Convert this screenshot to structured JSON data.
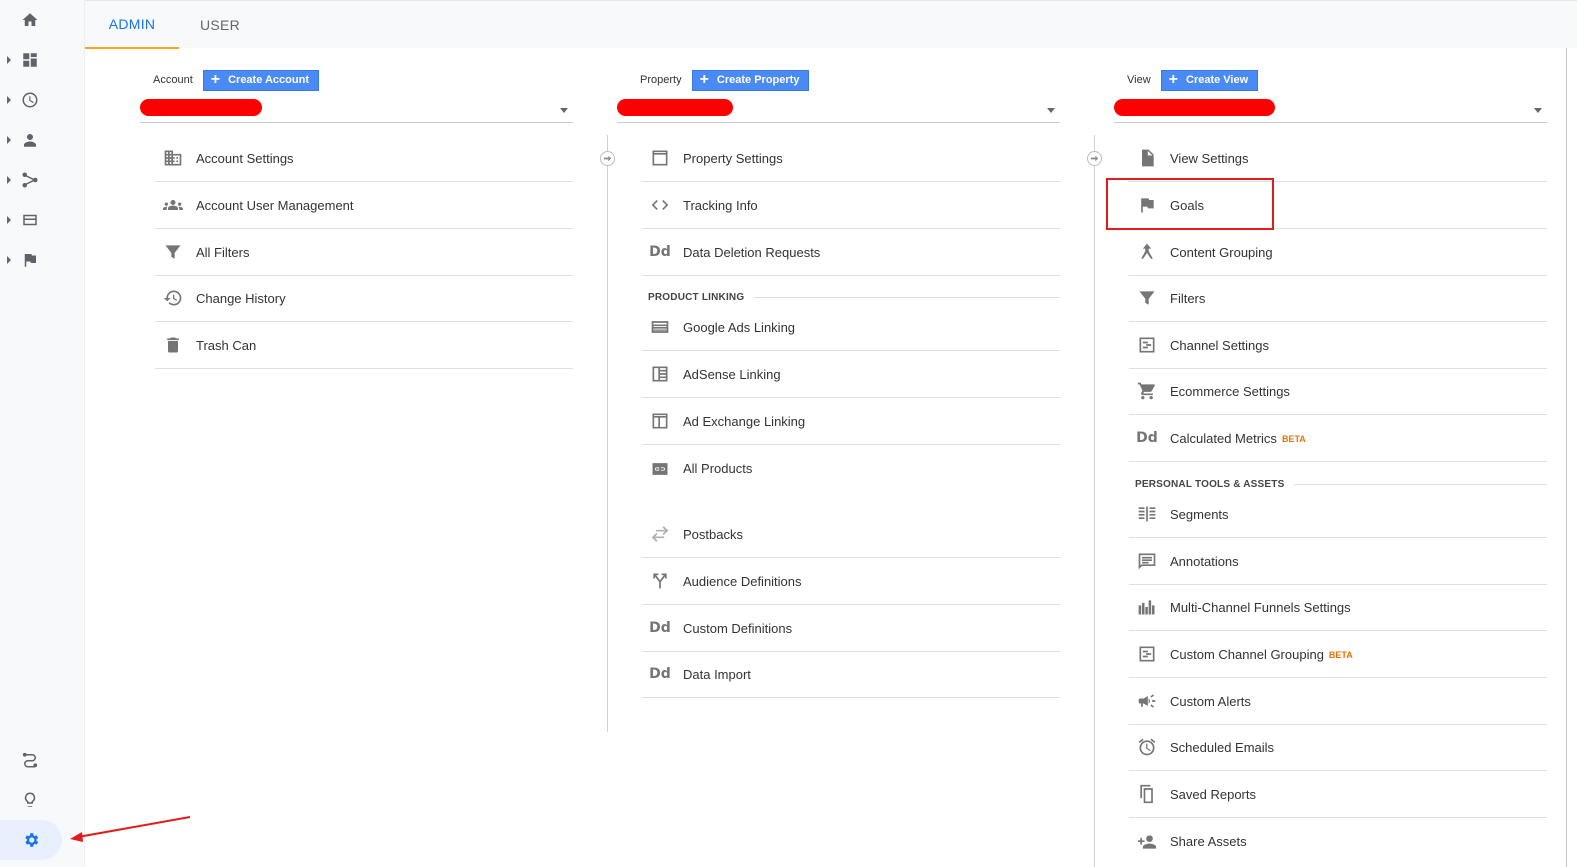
{
  "tabs": {
    "admin": "ADMIN",
    "user": "USER"
  },
  "account": {
    "label": "Account",
    "create": "Create Account",
    "items": [
      "Account Settings",
      "Account User Management",
      "All Filters",
      "Change History",
      "Trash Can"
    ]
  },
  "property": {
    "label": "Property",
    "create": "Create Property",
    "items": [
      "Property Settings",
      "Tracking Info",
      "Data Deletion Requests"
    ],
    "section": "PRODUCT LINKING",
    "linking": [
      "Google Ads Linking",
      "AdSense Linking",
      "Ad Exchange Linking",
      "All Products"
    ],
    "more": [
      "Postbacks",
      "Audience Definitions",
      "Custom Definitions",
      "Data Import"
    ]
  },
  "view": {
    "label": "View",
    "create": "Create View",
    "items": [
      "View Settings",
      "Goals",
      "Content Grouping",
      "Filters",
      "Channel Settings",
      "Ecommerce Settings",
      "Calculated Metrics"
    ],
    "section": "PERSONAL TOOLS & ASSETS",
    "tools": [
      "Segments",
      "Annotations",
      "Multi-Channel Funnels Settings",
      "Custom Channel Grouping",
      "Custom Alerts",
      "Scheduled Emails",
      "Saved Reports",
      "Share Assets"
    ],
    "beta": "BETA"
  },
  "dd_glyph": "Dd",
  "colors": {
    "accent": "#1a73e8",
    "tab_underline": "#f5a623",
    "button": "#4a8af4",
    "annotation_red": "#e21b1b",
    "beta": "#e8710a"
  }
}
